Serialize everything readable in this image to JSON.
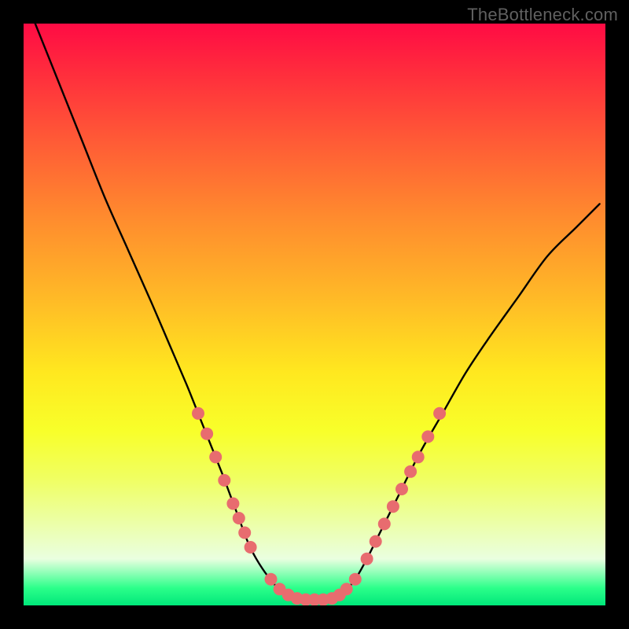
{
  "watermark": "TheBottleneck.com",
  "chart_data": {
    "type": "line",
    "title": "",
    "xlabel": "",
    "ylabel": "",
    "xlim": [
      0,
      100
    ],
    "ylim": [
      0,
      100
    ],
    "series": [
      {
        "name": "curve",
        "x": [
          2,
          6,
          10,
          14,
          18,
          22,
          25,
          28,
          30,
          32,
          34,
          35.5,
          37,
          38.5,
          40,
          42,
          44.5,
          47,
          50,
          53,
          55,
          57,
          59,
          61,
          64,
          68,
          72,
          76,
          80,
          85,
          90,
          95,
          99
        ],
        "y": [
          100,
          90,
          80,
          70,
          61,
          52,
          45,
          38,
          33,
          28,
          23,
          19,
          15,
          11,
          8,
          5,
          2.2,
          1.2,
          1,
          1.2,
          2.2,
          4.5,
          8,
          12,
          18,
          26,
          33,
          40,
          46,
          53,
          60,
          65,
          69
        ],
        "color": "#000000"
      }
    ],
    "markers": [
      {
        "x": 30.0,
        "y": 33.0
      },
      {
        "x": 31.5,
        "y": 29.5
      },
      {
        "x": 33.0,
        "y": 25.5
      },
      {
        "x": 34.5,
        "y": 21.5
      },
      {
        "x": 36.0,
        "y": 17.5
      },
      {
        "x": 37.0,
        "y": 15.0
      },
      {
        "x": 38.0,
        "y": 12.5
      },
      {
        "x": 39.0,
        "y": 10.0
      },
      {
        "x": 42.5,
        "y": 4.5
      },
      {
        "x": 44.0,
        "y": 2.8
      },
      {
        "x": 45.5,
        "y": 1.8
      },
      {
        "x": 47.0,
        "y": 1.2
      },
      {
        "x": 48.5,
        "y": 1.0
      },
      {
        "x": 50.0,
        "y": 1.0
      },
      {
        "x": 51.5,
        "y": 1.0
      },
      {
        "x": 53.0,
        "y": 1.2
      },
      {
        "x": 54.3,
        "y": 1.8
      },
      {
        "x": 55.5,
        "y": 2.8
      },
      {
        "x": 57.0,
        "y": 4.5
      },
      {
        "x": 59.0,
        "y": 8.0
      },
      {
        "x": 60.5,
        "y": 11.0
      },
      {
        "x": 62.0,
        "y": 14.0
      },
      {
        "x": 63.5,
        "y": 17.0
      },
      {
        "x": 65.0,
        "y": 20.0
      },
      {
        "x": 66.5,
        "y": 23.0
      },
      {
        "x": 67.8,
        "y": 25.5
      },
      {
        "x": 69.5,
        "y": 29.0
      },
      {
        "x": 71.5,
        "y": 33.0
      }
    ],
    "marker_color": "#e86c6f",
    "marker_radius": 8
  }
}
